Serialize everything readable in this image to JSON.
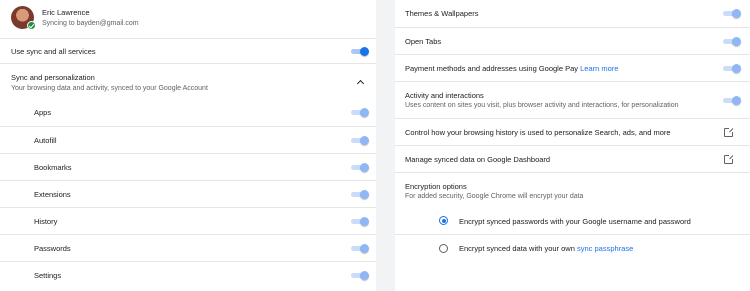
{
  "account": {
    "name": "Eric Lawrence",
    "status": "Syncing to bayden@gmail.com"
  },
  "sync_all": {
    "label": "Use sync and all services",
    "on": true
  },
  "sync_personalization": {
    "title": "Sync and personalization",
    "subtitle": "Your browsing data and activity, synced to your Google Account"
  },
  "sync_items": [
    {
      "label": "Apps",
      "on": true
    },
    {
      "label": "Autofill",
      "on": true
    },
    {
      "label": "Bookmarks",
      "on": true
    },
    {
      "label": "Extensions",
      "on": true
    },
    {
      "label": "History",
      "on": true
    },
    {
      "label": "Passwords",
      "on": true
    },
    {
      "label": "Settings",
      "on": true
    }
  ],
  "right": {
    "themes": "Themes & Wallpapers",
    "open_tabs": "Open Tabs",
    "payment": "Payment methods and addresses using Google Pay",
    "payment_link": "Learn more",
    "activity_title": "Activity and interactions",
    "activity_sub": "Uses content on sites you visit, plus browser activity and interactions, for personalization",
    "control_history": "Control how your browsing history is used to personalize Search, ads, and more",
    "manage_dashboard": "Manage synced data on Google Dashboard",
    "encryption_title": "Encryption options",
    "encryption_sub": "For added security, Google Chrome will encrypt your data",
    "encrypt_option_1": "Encrypt synced passwords with your Google username and password",
    "encrypt_option_2": "Encrypt synced data with your own",
    "encrypt_option_2_link": "sync passphrase"
  },
  "colors": {
    "accent": "#1a73e8",
    "track": "#a8c7fa",
    "text": "#202124",
    "subtext": "#5f6368"
  }
}
